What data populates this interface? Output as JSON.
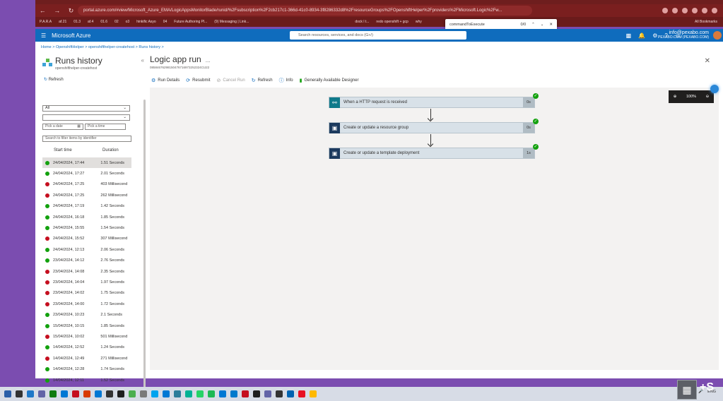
{
  "browser": {
    "url": "portal.azure.com/#view/Microsoft_Azure_EMA/LogicAppsMonitorBlade/runid/%2Fsubscription%2F2cb217c1-366d-41c0-8934-3f8286332d8%2FresourceGroups%2FOpenshiftHelper%2Fproviders%2FMicrosoft.Logic%2Fw...",
    "bookmarks": [
      "P.A.R.A",
      "af.21",
      "01.3",
      "af.4",
      "01.6",
      "02",
      "o3",
      "hinkific Asyo",
      "04",
      "Future Authoring Pl...",
      "(9) Messaging | Link...",
      "dock l t...",
      "redo openshift + gcp",
      "why"
    ],
    "all_bookmarks": "All Bookmarks"
  },
  "find_bar": {
    "term": "commandToExecute",
    "count": "0/0"
  },
  "azure": {
    "brand": "Microsoft Azure",
    "search_placeholder": "Search resources, services, and docs (G+/)",
    "user_email": "info@pexabo.com",
    "user_org": "PEXABO.COM (PEXABO.COM)"
  },
  "breadcrumb": [
    "Home",
    "OpenshiftHelper",
    "openshifthelper-createhost",
    "Runs history"
  ],
  "runs_panel": {
    "title": "Runs history",
    "subtitle": "openshifthelper-createhost",
    "refresh": "Refresh",
    "status_filter": "All",
    "second_filter": "",
    "date_placeholder": "Pick a date",
    "time_placeholder": "Pick a time",
    "search_placeholder": "Search to filter items by identifier",
    "col_start": "Start time",
    "col_duration": "Duration"
  },
  "runs": [
    {
      "status": "success",
      "start": "24/04/2024, 17:44",
      "duration": "1.51 Seconds"
    },
    {
      "status": "success",
      "start": "24/04/2024, 17:27",
      "duration": "2.01 Seconds"
    },
    {
      "status": "failed",
      "start": "24/04/2024, 17:25",
      "duration": "403 Millisecond"
    },
    {
      "status": "failed",
      "start": "24/04/2024, 17:25",
      "duration": "262 Millisecond"
    },
    {
      "status": "success",
      "start": "24/04/2024, 17:19",
      "duration": "1.42 Seconds"
    },
    {
      "status": "success",
      "start": "24/04/2024, 16:18",
      "duration": "1.85 Seconds"
    },
    {
      "status": "success",
      "start": "24/04/2024, 15:55",
      "duration": "1.54 Seconds"
    },
    {
      "status": "failed",
      "start": "24/04/2024, 15:52",
      "duration": "307 Millisecond"
    },
    {
      "status": "success",
      "start": "24/04/2024, 12:13",
      "duration": "2.06 Seconds"
    },
    {
      "status": "success",
      "start": "23/04/2024, 14:12",
      "duration": "2.76 Seconds"
    },
    {
      "status": "failed",
      "start": "23/04/2024, 14:08",
      "duration": "2.35 Seconds"
    },
    {
      "status": "failed",
      "start": "23/04/2024, 14:04",
      "duration": "1.97 Seconds"
    },
    {
      "status": "failed",
      "start": "23/04/2024, 14:02",
      "duration": "1.75 Seconds"
    },
    {
      "status": "failed",
      "start": "23/04/2024, 14:00",
      "duration": "1.72 Seconds"
    },
    {
      "status": "success",
      "start": "23/04/2024, 10:23",
      "duration": "2.1 Seconds"
    },
    {
      "status": "success",
      "start": "15/04/2024, 10:15",
      "duration": "1.85 Seconds"
    },
    {
      "status": "failed",
      "start": "15/04/2024, 10:02",
      "duration": "501 Millisecond"
    },
    {
      "status": "success",
      "start": "14/04/2024, 12:52",
      "duration": "1.24 Seconds"
    },
    {
      "status": "failed",
      "start": "14/04/2024, 12:49",
      "duration": "271 Millisecond"
    },
    {
      "status": "success",
      "start": "14/04/2024, 12:28",
      "duration": "1.74 Seconds"
    },
    {
      "status": "success",
      "start": "14/04/2024, 12:11",
      "duration": "1.52 Seconds"
    }
  ],
  "run": {
    "title": "Logic app run",
    "more": "...",
    "id": "08584676298150476716973252324CU22",
    "close": "✕"
  },
  "toolbar": {
    "run_details": "Run Details",
    "resubmit": "Resubmit",
    "cancel_run": "Cancel Run",
    "refresh": "Refresh",
    "info": "Info",
    "designer": "Generally Available Designer"
  },
  "steps": [
    {
      "label": "When a HTTP request is received",
      "duration": "0s",
      "icon": "http-trigger-icon"
    },
    {
      "label": "Create or update a resource group",
      "duration": "0s",
      "icon": "azure-cube-icon"
    },
    {
      "label": "Create or update a template deployment",
      "duration": "1s",
      "icon": "azure-cube-icon"
    }
  ],
  "zoom": {
    "level": "100%"
  },
  "tray": {
    "lang": "ENG"
  },
  "colors": {
    "success": "#13a10e",
    "failed": "#c50f1f",
    "azure_blue": "#0f6cbd",
    "chrome": "#7a1f1f",
    "desktop": "#7b4db0"
  }
}
